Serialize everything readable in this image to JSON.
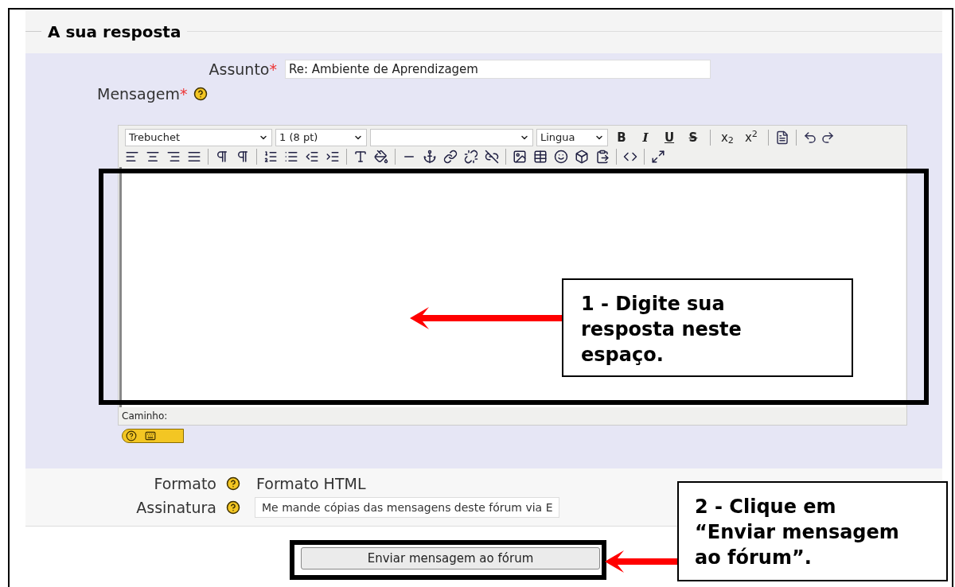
{
  "fieldset": {
    "legend": "A sua resposta"
  },
  "subject": {
    "label": "Assunto",
    "required_mark": "*",
    "value": "Re: Ambiente de Aprendizagem"
  },
  "message": {
    "label": "Mensagem",
    "required_mark": "*"
  },
  "toolbar": [
    {
      "kind": "select",
      "value": "Trebuchet"
    },
    {
      "kind": "select",
      "value": "1 (8 pt)"
    },
    {
      "kind": "select"
    },
    {
      "kind": "select",
      "value": "Lingua"
    },
    {
      "kind": "text_button",
      "label": "B"
    },
    {
      "kind": "text_button",
      "label": "I"
    },
    {
      "kind": "text_button",
      "label": "U"
    },
    {
      "kind": "text_button",
      "label": "S"
    },
    {
      "kind": "separator"
    },
    {
      "kind": "text_button",
      "label": "x$_{2}$"
    },
    {
      "kind": "text_button",
      "label": "x$^{2}$"
    },
    {
      "kind": "separator"
    }
  ],
  "editor": {
    "path_label": "Caminho:"
  },
  "format": {
    "label": "Formato",
    "value": "Formato HTML"
  },
  "signature": {
    "label": "Assinatura",
    "value": "Me mande cópias das mensagens deste fórum via E"
  },
  "submit": {
    "label": "Enviar mensagem ao fórum"
  },
  "callouts": [
    {
      "text": "1 - Digite sua resposta neste espaço."
    },
    {
      "text": "2 - Clique em “Enviar mensagem ao fórum”."
    }
  ]
}
